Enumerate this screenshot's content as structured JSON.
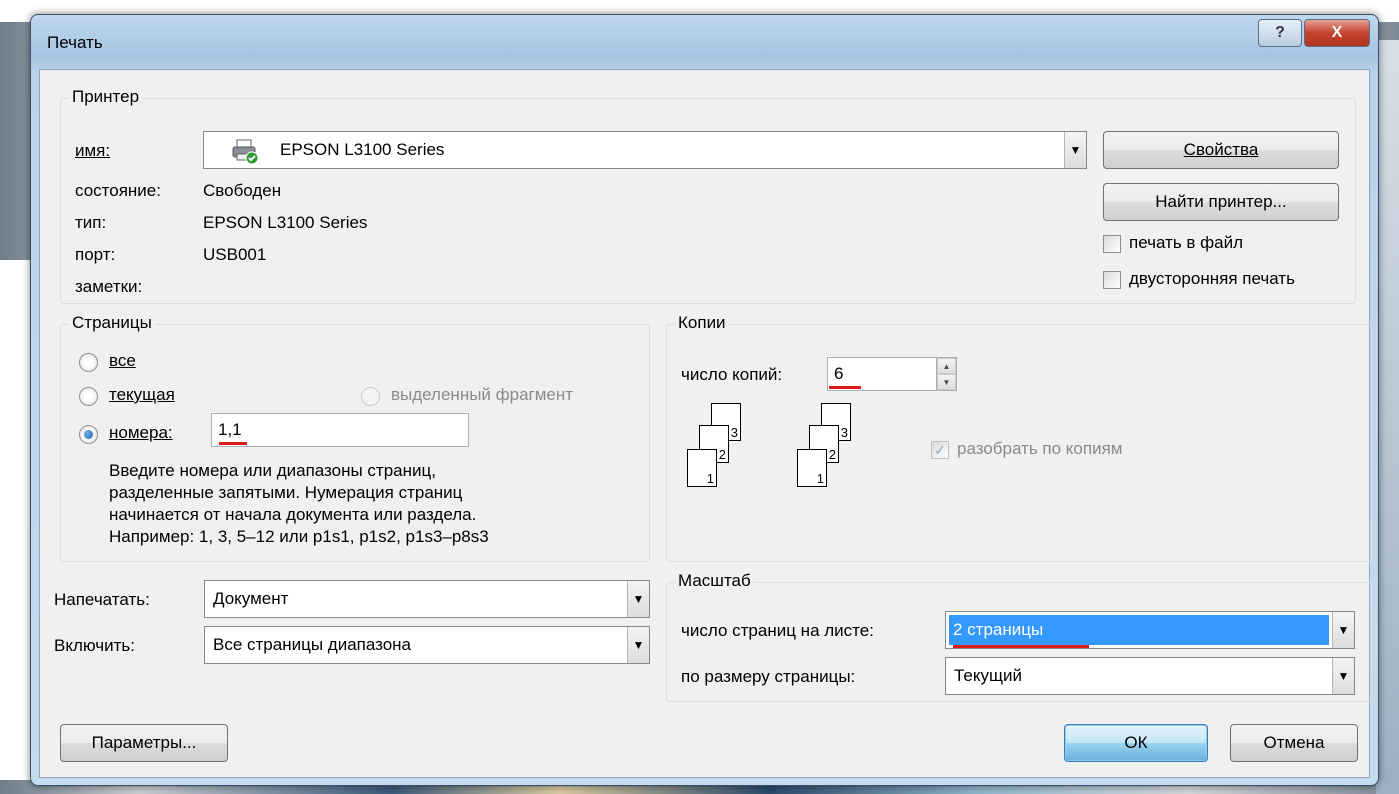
{
  "window": {
    "title": "Печать",
    "help_glyph": "?",
    "close_glyph": "X"
  },
  "printer": {
    "group_label": "Принтер",
    "name_label": "имя:",
    "name_value": "EPSON L3100 Series",
    "status_label": "состояние:",
    "status_value": "Свободен",
    "type_label": "тип:",
    "type_value": "EPSON L3100 Series",
    "port_label": "порт:",
    "port_value": "USB001",
    "notes_label": "заметки:",
    "properties_button": "Свойства",
    "find_button": "Найти принтер...",
    "print_to_file": "печать в файл",
    "duplex": "двусторонняя печать"
  },
  "pages": {
    "group_label": "Страницы",
    "all": "все",
    "current": "текущая",
    "selection": "выделенный фрагмент",
    "numbers": "номера:",
    "numbers_value": "1,1",
    "hint_1": "Введите номера или диапазоны страниц,",
    "hint_2": "разделенные запятыми. Нумерация страниц",
    "hint_3": "начинается от начала документа или раздела.",
    "hint_4": "Например: 1, 3, 5–12 или p1s1, p1s2, p1s3–p8s3"
  },
  "copies": {
    "group_label": "Копии",
    "count_label": "число копий:",
    "count_value": "6",
    "collate": "разобрать по копиям",
    "page_numbers": [
      "1",
      "2",
      "3"
    ]
  },
  "print_what": {
    "print_label": "Напечатать:",
    "print_value": "Документ",
    "include_label": "Включить:",
    "include_value": "Все страницы диапазона"
  },
  "zoom": {
    "group_label": "Масштаб",
    "pages_per_sheet_label": "число страниц на листе:",
    "pages_per_sheet_value": "2 страницы",
    "scale_label": "по размеру страницы:",
    "scale_value": "Текущий"
  },
  "footer": {
    "options_button": "Параметры...",
    "ok_button": "ОК",
    "cancel_button": "Отмена"
  },
  "colors": {
    "accent_selection": "#3399ff",
    "annotation_red": "#e0191b"
  }
}
